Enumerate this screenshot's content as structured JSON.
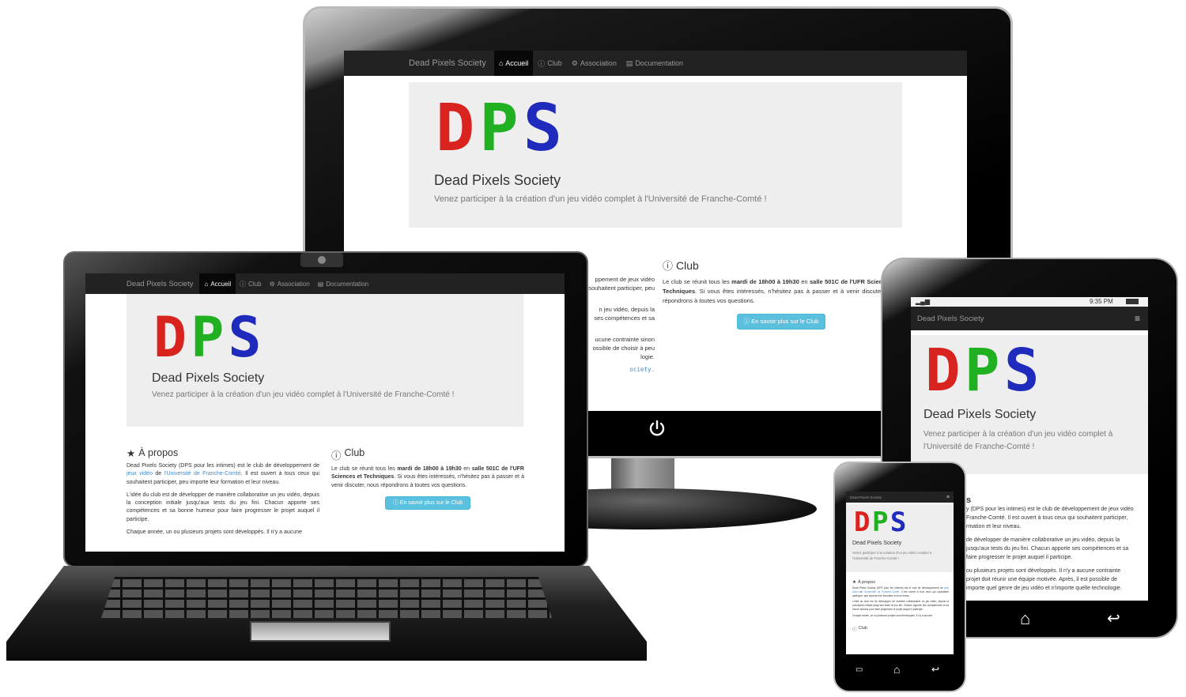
{
  "site": {
    "brand": "Dead Pixels Society",
    "nav": [
      {
        "label": "Accueil",
        "icon": "home-icon",
        "active": true
      },
      {
        "label": "Club",
        "icon": "info-circle-icon"
      },
      {
        "label": "Association",
        "icon": "gear-icon"
      },
      {
        "label": "Documentation",
        "icon": "book-icon"
      }
    ],
    "logo_letters": [
      "D",
      "P",
      "S"
    ],
    "title": "Dead Pixels Society",
    "tagline": "Venez participer à la création d'un jeu vidéo complet à l'Université de Franche-Comté !",
    "tagline_line1": "Venez participer à la création d'un jeu vidéo complet à",
    "tagline_line2": "l'Université de Franche-Comté !",
    "about": {
      "heading": "À propos",
      "p1_a": "Dead Pixels Society (DPS pour les intimes) est le club de développement de ",
      "p1_link1": "jeux vidéo",
      "p1_b": " de ",
      "p1_link2": "l'Université de Franche-Comté",
      "p1_c": ". Il est ouvert à tous ceux qui souhaitent participer, peu importe leur formation et leur niveau.",
      "p2": "L'idée du club est de développer de manière collaborative un jeu vidéo, depuis la conception initiale jusqu'aux tests du jeu fini. Chacun apporte ses compétences et sa bonne humeur pour faire progresser le projet auquel il participe.",
      "p3": "Chaque année, un ou plusieurs projets sont développés. Il n'y a aucune"
    },
    "club": {
      "heading": "Club",
      "p_a": "Le club se réunit tous les ",
      "p_b1": "mardi de 18h00 à 19h30",
      "p_c": " en ",
      "p_b2": "salle 501C de l'UFR Sciences et Techniques",
      "p_d": ". Si vous êtes intéressés, n'hésitez pas à passer et à venir discuter, nous répondrons à toutes vos questions.",
      "button": "En savoir plus sur le Club"
    },
    "monitor_left_fragments": [
      "ppement de jeux vidéo",
      "souhaitent participer, peu",
      "n jeu vidéo, depuis la",
      "ses compétences et sa",
      "ucune contrainte sinon",
      "ossible de choisir à peu",
      "logie.",
      "ociety."
    ],
    "tablet_right_fragments": [
      "s",
      "y (DPS pour les intimes) est le club de développement de jeux vidéo",
      "Franche-Comté. Il est ouvert à tous ceux qui souhaitent participer,",
      "rmation et leur niveau.",
      "de développer de manière collaborative un jeu vidéo, depuis la",
      "jusqu'aux tests du jeu fini. Chacun apporte ses compétences et sa",
      "faire progresser le projet auquel il participe.",
      "ou plusieurs projets sont développés. Il n'y a aucune contrainte",
      "projet doit réunir une équipe motivée. Après, il est possible de",
      "importe quel genre de jeu vidéo et n'importe quelle technologie."
    ],
    "phone_about_heading": "À propos",
    "phone_club_heading": "Club"
  },
  "tablet_status": {
    "time": "9:35 PM"
  },
  "colors": {
    "navbar": "#222222",
    "jumbotron": "#eeeeee",
    "link": "#428bca",
    "button_info": "#5bc0de",
    "logo_d": "#d9231f",
    "logo_p": "#21b021",
    "logo_s": "#1f2bbd"
  }
}
